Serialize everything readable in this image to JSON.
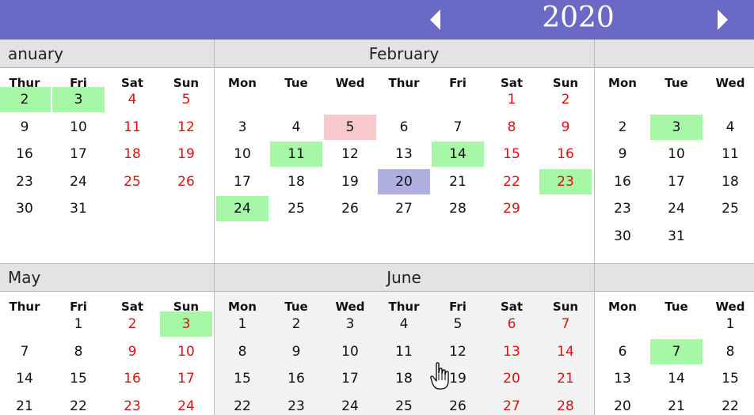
{
  "header": {
    "year": "2020",
    "prev_icon": "triangle-left-icon",
    "next_icon": "triangle-right-icon",
    "background": "#6a6ac6"
  },
  "colors": {
    "weekend": "#dd1010",
    "green_highlight": "#a6f7a6",
    "pink_highlight": "#f7c8cc",
    "blue_highlight": "#b0b0e0",
    "title_bar": "#e3e3e3"
  },
  "months": [
    {
      "id": "january",
      "title": "anuary",
      "title_align": "left",
      "shaded": false,
      "dow": [
        "Thur",
        "Fri",
        "Sat",
        "Sun"
      ],
      "rows": [
        [
          {
            "t": "2",
            "h": "green"
          },
          {
            "t": "3",
            "h": "green"
          },
          {
            "t": "4",
            "w": true
          },
          {
            "t": "5",
            "w": true
          }
        ],
        [
          {
            "t": "9"
          },
          {
            "t": "10"
          },
          {
            "t": "11",
            "w": true
          },
          {
            "t": "12",
            "w": true
          }
        ],
        [
          {
            "t": "16"
          },
          {
            "t": "17"
          },
          {
            "t": "18",
            "w": true
          },
          {
            "t": "19",
            "w": true
          }
        ],
        [
          {
            "t": "23"
          },
          {
            "t": "24"
          },
          {
            "t": "25",
            "w": true
          },
          {
            "t": "26",
            "w": true
          }
        ],
        [
          {
            "t": "30"
          },
          {
            "t": "31"
          },
          null,
          null
        ]
      ]
    },
    {
      "id": "february",
      "title": "February",
      "title_align": "center",
      "shaded": false,
      "dow": [
        "Mon",
        "Tue",
        "Wed",
        "Thur",
        "Fri",
        "Sat",
        "Sun"
      ],
      "rows": [
        [
          null,
          null,
          null,
          null,
          null,
          {
            "t": "1",
            "w": true
          },
          {
            "t": "2",
            "w": true
          }
        ],
        [
          {
            "t": "3"
          },
          {
            "t": "4"
          },
          {
            "t": "5",
            "h": "pink"
          },
          {
            "t": "6"
          },
          {
            "t": "7"
          },
          {
            "t": "8",
            "w": true
          },
          {
            "t": "9",
            "w": true
          }
        ],
        [
          {
            "t": "10"
          },
          {
            "t": "11",
            "h": "green"
          },
          {
            "t": "12"
          },
          {
            "t": "13"
          },
          {
            "t": "14",
            "h": "green"
          },
          {
            "t": "15",
            "w": true
          },
          {
            "t": "16",
            "w": true
          }
        ],
        [
          {
            "t": "17"
          },
          {
            "t": "18"
          },
          {
            "t": "19"
          },
          {
            "t": "20",
            "h": "blue"
          },
          {
            "t": "21"
          },
          {
            "t": "22",
            "w": true
          },
          {
            "t": "23",
            "w": true,
            "h": "green"
          }
        ],
        [
          {
            "t": "24",
            "h": "green"
          },
          {
            "t": "25"
          },
          {
            "t": "26"
          },
          {
            "t": "27"
          },
          {
            "t": "28"
          },
          {
            "t": "29",
            "w": true
          },
          null
        ]
      ]
    },
    {
      "id": "march",
      "title": "",
      "title_align": "center",
      "shaded": false,
      "dow": [
        "Mon",
        "Tue",
        "Wed"
      ],
      "rows": [
        [
          null,
          null,
          null
        ],
        [
          {
            "t": "2"
          },
          {
            "t": "3",
            "h": "green"
          },
          {
            "t": "4"
          }
        ],
        [
          {
            "t": "9"
          },
          {
            "t": "10"
          },
          {
            "t": "11"
          }
        ],
        [
          {
            "t": "16"
          },
          {
            "t": "17"
          },
          {
            "t": "18"
          }
        ],
        [
          {
            "t": "23"
          },
          {
            "t": "24"
          },
          {
            "t": "25"
          }
        ],
        [
          {
            "t": "30"
          },
          {
            "t": "31"
          },
          null
        ]
      ]
    },
    {
      "id": "may",
      "title": "May",
      "title_align": "left",
      "shaded": false,
      "dow": [
        "Thur",
        "Fri",
        "Sat",
        "Sun"
      ],
      "rows": [
        [
          null,
          {
            "t": "1"
          },
          {
            "t": "2",
            "w": true
          },
          {
            "t": "3",
            "w": true,
            "h": "green"
          }
        ],
        [
          {
            "t": "7"
          },
          {
            "t": "8"
          },
          {
            "t": "9",
            "w": true
          },
          {
            "t": "10",
            "w": true
          }
        ],
        [
          {
            "t": "14"
          },
          {
            "t": "15"
          },
          {
            "t": "16",
            "w": true
          },
          {
            "t": "17",
            "w": true
          }
        ],
        [
          {
            "t": "21"
          },
          {
            "t": "22"
          },
          {
            "t": "23",
            "w": true
          },
          {
            "t": "24",
            "w": true
          }
        ]
      ]
    },
    {
      "id": "june",
      "title": "June",
      "title_align": "center",
      "shaded": true,
      "dow": [
        "Mon",
        "Tue",
        "Wed",
        "Thur",
        "Fri",
        "Sat",
        "Sun"
      ],
      "rows": [
        [
          {
            "t": "1"
          },
          {
            "t": "2"
          },
          {
            "t": "3"
          },
          {
            "t": "4"
          },
          {
            "t": "5"
          },
          {
            "t": "6",
            "w": true
          },
          {
            "t": "7",
            "w": true
          }
        ],
        [
          {
            "t": "8"
          },
          {
            "t": "9"
          },
          {
            "t": "10"
          },
          {
            "t": "11"
          },
          {
            "t": "12"
          },
          {
            "t": "13",
            "w": true
          },
          {
            "t": "14",
            "w": true
          }
        ],
        [
          {
            "t": "15"
          },
          {
            "t": "16"
          },
          {
            "t": "17"
          },
          {
            "t": "18"
          },
          {
            "t": "19"
          },
          {
            "t": "20",
            "w": true
          },
          {
            "t": "21",
            "w": true
          }
        ],
        [
          {
            "t": "22"
          },
          {
            "t": "23"
          },
          {
            "t": "24"
          },
          {
            "t": "25"
          },
          {
            "t": "26"
          },
          {
            "t": "27",
            "w": true
          },
          {
            "t": "28",
            "w": true
          }
        ]
      ]
    },
    {
      "id": "july",
      "title": "",
      "title_align": "center",
      "shaded": false,
      "dow": [
        "Mon",
        "Tue",
        "Wed"
      ],
      "rows": [
        [
          null,
          null,
          {
            "t": "1"
          }
        ],
        [
          {
            "t": "6"
          },
          {
            "t": "7",
            "h": "green"
          },
          {
            "t": "8"
          }
        ],
        [
          {
            "t": "13"
          },
          {
            "t": "14"
          },
          {
            "t": "15"
          }
        ],
        [
          {
            "t": "20"
          },
          {
            "t": "21"
          },
          {
            "t": "22"
          }
        ]
      ]
    }
  ]
}
